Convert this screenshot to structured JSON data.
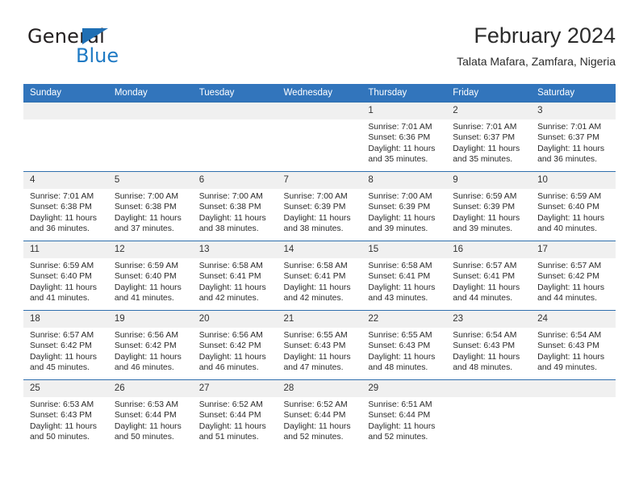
{
  "logo": {
    "word_one": "General",
    "word_two": "Blue",
    "triangle_icon": "blue-triangle-icon"
  },
  "header": {
    "title": "February 2024",
    "subtitle": "Talata Mafara, Zamfara, Nigeria"
  },
  "colors": {
    "header_blue": "#3275bc",
    "row_border_blue": "#2f6fad",
    "daynum_band": "#f0f0f0",
    "logo_blue": "#1f7ac4",
    "text": "#2b2b2b"
  },
  "labels": {
    "sunrise": "Sunrise:",
    "sunset": "Sunset:",
    "daylight": "Daylight:"
  },
  "weekdays": [
    "Sunday",
    "Monday",
    "Tuesday",
    "Wednesday",
    "Thursday",
    "Friday",
    "Saturday"
  ],
  "weeks": [
    [
      {
        "empty": true,
        "day": ""
      },
      {
        "empty": true,
        "day": ""
      },
      {
        "empty": true,
        "day": ""
      },
      {
        "empty": true,
        "day": ""
      },
      {
        "day": "1",
        "sunrise": "Sunrise: 7:01 AM",
        "sunset": "Sunset: 6:36 PM",
        "daylight": "Daylight: 11 hours and 35 minutes."
      },
      {
        "day": "2",
        "sunrise": "Sunrise: 7:01 AM",
        "sunset": "Sunset: 6:37 PM",
        "daylight": "Daylight: 11 hours and 35 minutes."
      },
      {
        "day": "3",
        "sunrise": "Sunrise: 7:01 AM",
        "sunset": "Sunset: 6:37 PM",
        "daylight": "Daylight: 11 hours and 36 minutes."
      }
    ],
    [
      {
        "day": "4",
        "sunrise": "Sunrise: 7:01 AM",
        "sunset": "Sunset: 6:38 PM",
        "daylight": "Daylight: 11 hours and 36 minutes."
      },
      {
        "day": "5",
        "sunrise": "Sunrise: 7:00 AM",
        "sunset": "Sunset: 6:38 PM",
        "daylight": "Daylight: 11 hours and 37 minutes."
      },
      {
        "day": "6",
        "sunrise": "Sunrise: 7:00 AM",
        "sunset": "Sunset: 6:38 PM",
        "daylight": "Daylight: 11 hours and 38 minutes."
      },
      {
        "day": "7",
        "sunrise": "Sunrise: 7:00 AM",
        "sunset": "Sunset: 6:39 PM",
        "daylight": "Daylight: 11 hours and 38 minutes."
      },
      {
        "day": "8",
        "sunrise": "Sunrise: 7:00 AM",
        "sunset": "Sunset: 6:39 PM",
        "daylight": "Daylight: 11 hours and 39 minutes."
      },
      {
        "day": "9",
        "sunrise": "Sunrise: 6:59 AM",
        "sunset": "Sunset: 6:39 PM",
        "daylight": "Daylight: 11 hours and 39 minutes."
      },
      {
        "day": "10",
        "sunrise": "Sunrise: 6:59 AM",
        "sunset": "Sunset: 6:40 PM",
        "daylight": "Daylight: 11 hours and 40 minutes."
      }
    ],
    [
      {
        "day": "11",
        "sunrise": "Sunrise: 6:59 AM",
        "sunset": "Sunset: 6:40 PM",
        "daylight": "Daylight: 11 hours and 41 minutes."
      },
      {
        "day": "12",
        "sunrise": "Sunrise: 6:59 AM",
        "sunset": "Sunset: 6:40 PM",
        "daylight": "Daylight: 11 hours and 41 minutes."
      },
      {
        "day": "13",
        "sunrise": "Sunrise: 6:58 AM",
        "sunset": "Sunset: 6:41 PM",
        "daylight": "Daylight: 11 hours and 42 minutes."
      },
      {
        "day": "14",
        "sunrise": "Sunrise: 6:58 AM",
        "sunset": "Sunset: 6:41 PM",
        "daylight": "Daylight: 11 hours and 42 minutes."
      },
      {
        "day": "15",
        "sunrise": "Sunrise: 6:58 AM",
        "sunset": "Sunset: 6:41 PM",
        "daylight": "Daylight: 11 hours and 43 minutes."
      },
      {
        "day": "16",
        "sunrise": "Sunrise: 6:57 AM",
        "sunset": "Sunset: 6:41 PM",
        "daylight": "Daylight: 11 hours and 44 minutes."
      },
      {
        "day": "17",
        "sunrise": "Sunrise: 6:57 AM",
        "sunset": "Sunset: 6:42 PM",
        "daylight": "Daylight: 11 hours and 44 minutes."
      }
    ],
    [
      {
        "day": "18",
        "sunrise": "Sunrise: 6:57 AM",
        "sunset": "Sunset: 6:42 PM",
        "daylight": "Daylight: 11 hours and 45 minutes."
      },
      {
        "day": "19",
        "sunrise": "Sunrise: 6:56 AM",
        "sunset": "Sunset: 6:42 PM",
        "daylight": "Daylight: 11 hours and 46 minutes."
      },
      {
        "day": "20",
        "sunrise": "Sunrise: 6:56 AM",
        "sunset": "Sunset: 6:42 PM",
        "daylight": "Daylight: 11 hours and 46 minutes."
      },
      {
        "day": "21",
        "sunrise": "Sunrise: 6:55 AM",
        "sunset": "Sunset: 6:43 PM",
        "daylight": "Daylight: 11 hours and 47 minutes."
      },
      {
        "day": "22",
        "sunrise": "Sunrise: 6:55 AM",
        "sunset": "Sunset: 6:43 PM",
        "daylight": "Daylight: 11 hours and 48 minutes."
      },
      {
        "day": "23",
        "sunrise": "Sunrise: 6:54 AM",
        "sunset": "Sunset: 6:43 PM",
        "daylight": "Daylight: 11 hours and 48 minutes."
      },
      {
        "day": "24",
        "sunrise": "Sunrise: 6:54 AM",
        "sunset": "Sunset: 6:43 PM",
        "daylight": "Daylight: 11 hours and 49 minutes."
      }
    ],
    [
      {
        "day": "25",
        "sunrise": "Sunrise: 6:53 AM",
        "sunset": "Sunset: 6:43 PM",
        "daylight": "Daylight: 11 hours and 50 minutes."
      },
      {
        "day": "26",
        "sunrise": "Sunrise: 6:53 AM",
        "sunset": "Sunset: 6:44 PM",
        "daylight": "Daylight: 11 hours and 50 minutes."
      },
      {
        "day": "27",
        "sunrise": "Sunrise: 6:52 AM",
        "sunset": "Sunset: 6:44 PM",
        "daylight": "Daylight: 11 hours and 51 minutes."
      },
      {
        "day": "28",
        "sunrise": "Sunrise: 6:52 AM",
        "sunset": "Sunset: 6:44 PM",
        "daylight": "Daylight: 11 hours and 52 minutes."
      },
      {
        "day": "29",
        "sunrise": "Sunrise: 6:51 AM",
        "sunset": "Sunset: 6:44 PM",
        "daylight": "Daylight: 11 hours and 52 minutes."
      },
      {
        "empty": true,
        "day": ""
      },
      {
        "empty": true,
        "day": ""
      }
    ]
  ]
}
